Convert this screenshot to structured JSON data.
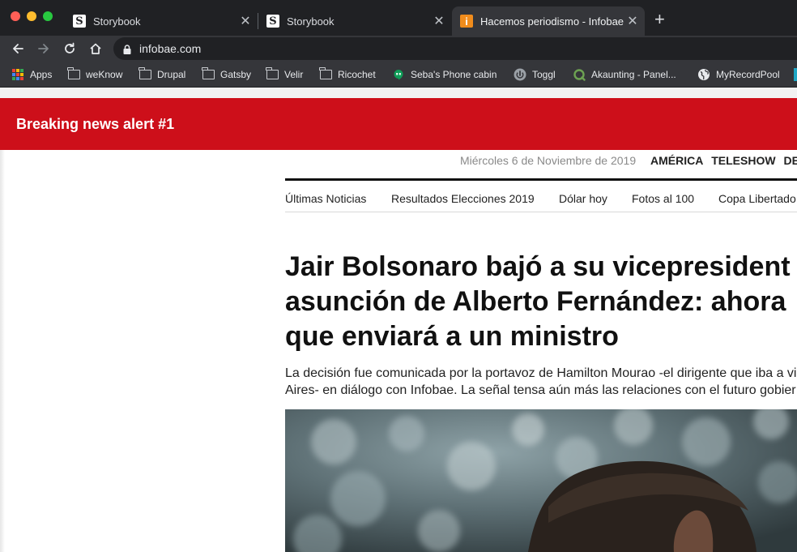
{
  "browser": {
    "tabs": [
      {
        "title": "Storybook",
        "favicon": "S",
        "active": false
      },
      {
        "title": "Storybook",
        "favicon": "S",
        "active": false
      },
      {
        "title": "Hacemos periodismo - Infobae",
        "favicon": "i",
        "active": true
      }
    ],
    "close_glyph": "✕",
    "new_tab_glyph": "+",
    "url": "infobae.com"
  },
  "bookmarks": [
    {
      "label": "Apps",
      "icon": "apps-grid-icon"
    },
    {
      "label": "weKnow",
      "icon": "folder-icon"
    },
    {
      "label": "Drupal",
      "icon": "folder-icon"
    },
    {
      "label": "Gatsby",
      "icon": "folder-icon"
    },
    {
      "label": "Velir",
      "icon": "folder-icon"
    },
    {
      "label": "Ricochet",
      "icon": "folder-icon"
    },
    {
      "label": "Seba's Phone cabin",
      "icon": "hangouts-icon"
    },
    {
      "label": "Toggl",
      "icon": "toggl-icon"
    },
    {
      "label": "Akaunting - Panel...",
      "icon": "akaunting-icon"
    },
    {
      "label": "MyRecordPool",
      "icon": "globe-icon"
    }
  ],
  "alert": {
    "text": "Breaking news alert #1",
    "color": "#cd0f1a"
  },
  "header": {
    "date": "Miércoles 6 de Noviembre de 2019",
    "sections": [
      "AMÉRICA",
      "TELESHOW",
      "DEP"
    ]
  },
  "nav": {
    "items": [
      "Últimas Noticias",
      "Resultados Elecciones 2019",
      "Dólar hoy",
      "Fotos al 100",
      "Copa Libertado"
    ]
  },
  "article": {
    "headline_lines": [
      "Jair Bolsonaro bajó a su vicepresident",
      "asunción de Alberto Fernández: ahora",
      "que enviará a un ministro"
    ],
    "deck_lines": [
      "La decisión fue comunicada por la portavoz de Hamilton Mourao -el dirigente que iba a vi",
      "Aires- en diálogo con Infobae. La señal tensa aún más las relaciones con el futuro gobier"
    ]
  }
}
